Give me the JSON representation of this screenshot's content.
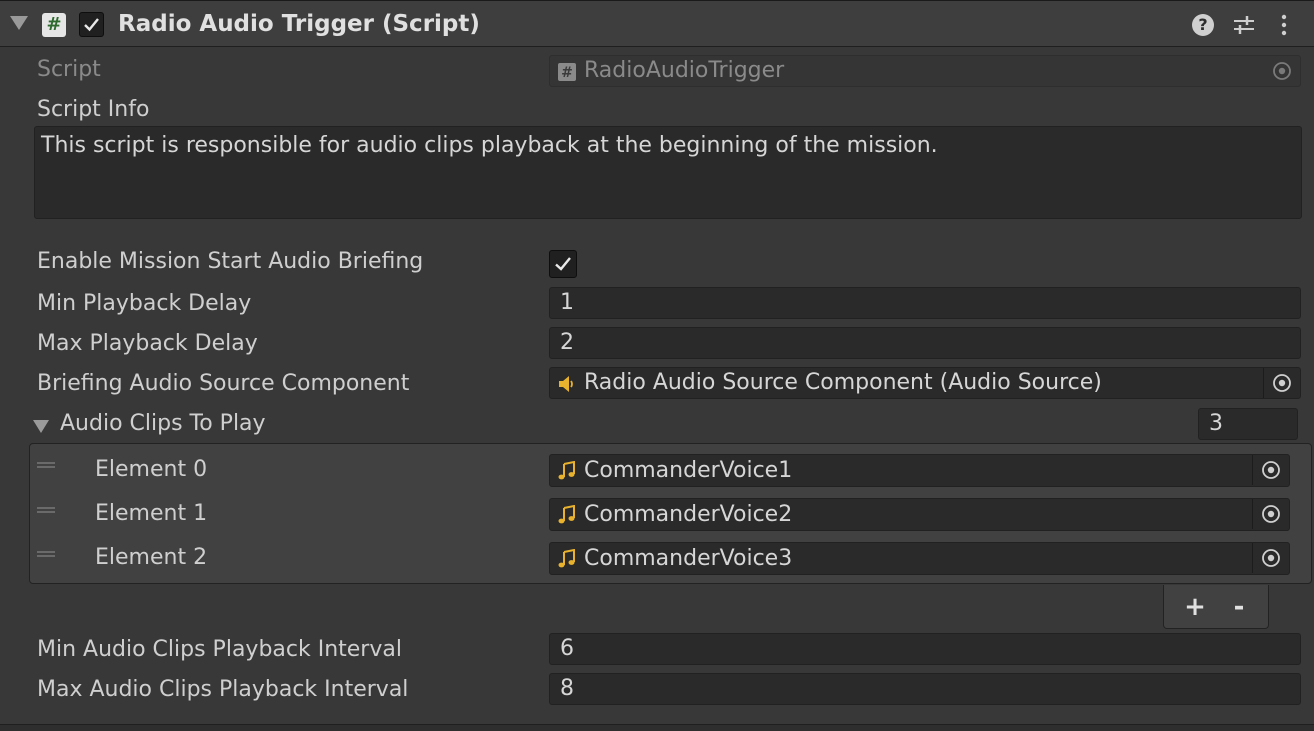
{
  "header": {
    "title": "Radio Audio Trigger (Script)",
    "enabled": true,
    "script_icon_glyph": "#",
    "help_glyph": "?"
  },
  "script_row": {
    "label": "Script",
    "value": "RadioAudioTrigger"
  },
  "script_info": {
    "label": "Script Info",
    "text": "This script is responsible for audio clips playback at the beginning of the mission."
  },
  "fields": {
    "enable_briefing": {
      "label": "Enable Mission Start Audio Briefing",
      "checked": true
    },
    "min_delay": {
      "label": "Min Playback Delay",
      "value": "1"
    },
    "max_delay": {
      "label": "Max Playback Delay",
      "value": "2"
    },
    "audio_source": {
      "label": "Briefing Audio Source Component",
      "value": "Radio Audio Source Component (Audio Source)"
    },
    "min_interval": {
      "label": "Min Audio Clips Playback Interval",
      "value": "6"
    },
    "max_interval": {
      "label": "Max Audio Clips Playback Interval",
      "value": "8"
    }
  },
  "clips": {
    "label": "Audio Clips To Play",
    "size": "3",
    "elements": [
      {
        "label": "Element 0",
        "value": "CommanderVoice1"
      },
      {
        "label": "Element 1",
        "value": "CommanderVoice2"
      },
      {
        "label": "Element 2",
        "value": "CommanderVoice3"
      }
    ],
    "add_label": "+",
    "remove_label": "-"
  },
  "colors": {
    "background": "#383838",
    "field": "#2a2a2a",
    "accent_audio": "#e8b22e",
    "script_icon_green": "#2f6b2f"
  }
}
